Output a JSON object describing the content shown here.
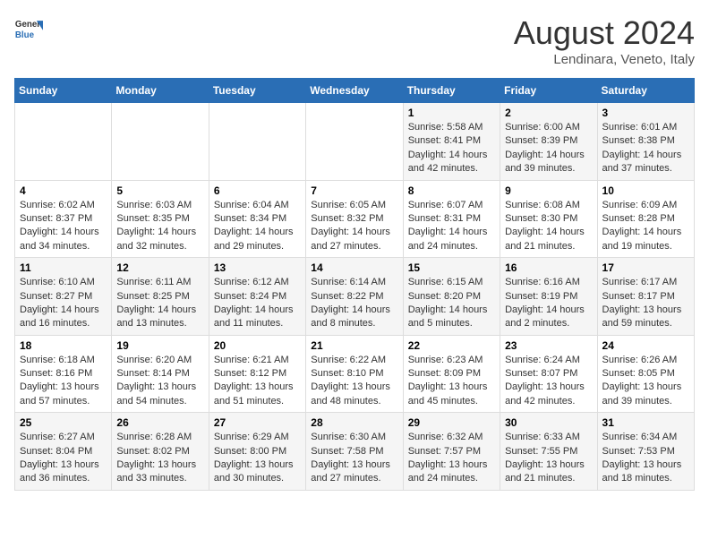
{
  "header": {
    "logo_line1": "General",
    "logo_line2": "Blue",
    "month": "August 2024",
    "location": "Lendinara, Veneto, Italy"
  },
  "days_of_week": [
    "Sunday",
    "Monday",
    "Tuesday",
    "Wednesday",
    "Thursday",
    "Friday",
    "Saturday"
  ],
  "weeks": [
    [
      {
        "day": "",
        "info": ""
      },
      {
        "day": "",
        "info": ""
      },
      {
        "day": "",
        "info": ""
      },
      {
        "day": "",
        "info": ""
      },
      {
        "day": "1",
        "info": "Sunrise: 5:58 AM\nSunset: 8:41 PM\nDaylight: 14 hours and 42 minutes."
      },
      {
        "day": "2",
        "info": "Sunrise: 6:00 AM\nSunset: 8:39 PM\nDaylight: 14 hours and 39 minutes."
      },
      {
        "day": "3",
        "info": "Sunrise: 6:01 AM\nSunset: 8:38 PM\nDaylight: 14 hours and 37 minutes."
      }
    ],
    [
      {
        "day": "4",
        "info": "Sunrise: 6:02 AM\nSunset: 8:37 PM\nDaylight: 14 hours and 34 minutes."
      },
      {
        "day": "5",
        "info": "Sunrise: 6:03 AM\nSunset: 8:35 PM\nDaylight: 14 hours and 32 minutes."
      },
      {
        "day": "6",
        "info": "Sunrise: 6:04 AM\nSunset: 8:34 PM\nDaylight: 14 hours and 29 minutes."
      },
      {
        "day": "7",
        "info": "Sunrise: 6:05 AM\nSunset: 8:32 PM\nDaylight: 14 hours and 27 minutes."
      },
      {
        "day": "8",
        "info": "Sunrise: 6:07 AM\nSunset: 8:31 PM\nDaylight: 14 hours and 24 minutes."
      },
      {
        "day": "9",
        "info": "Sunrise: 6:08 AM\nSunset: 8:30 PM\nDaylight: 14 hours and 21 minutes."
      },
      {
        "day": "10",
        "info": "Sunrise: 6:09 AM\nSunset: 8:28 PM\nDaylight: 14 hours and 19 minutes."
      }
    ],
    [
      {
        "day": "11",
        "info": "Sunrise: 6:10 AM\nSunset: 8:27 PM\nDaylight: 14 hours and 16 minutes."
      },
      {
        "day": "12",
        "info": "Sunrise: 6:11 AM\nSunset: 8:25 PM\nDaylight: 14 hours and 13 minutes."
      },
      {
        "day": "13",
        "info": "Sunrise: 6:12 AM\nSunset: 8:24 PM\nDaylight: 14 hours and 11 minutes."
      },
      {
        "day": "14",
        "info": "Sunrise: 6:14 AM\nSunset: 8:22 PM\nDaylight: 14 hours and 8 minutes."
      },
      {
        "day": "15",
        "info": "Sunrise: 6:15 AM\nSunset: 8:20 PM\nDaylight: 14 hours and 5 minutes."
      },
      {
        "day": "16",
        "info": "Sunrise: 6:16 AM\nSunset: 8:19 PM\nDaylight: 14 hours and 2 minutes."
      },
      {
        "day": "17",
        "info": "Sunrise: 6:17 AM\nSunset: 8:17 PM\nDaylight: 13 hours and 59 minutes."
      }
    ],
    [
      {
        "day": "18",
        "info": "Sunrise: 6:18 AM\nSunset: 8:16 PM\nDaylight: 13 hours and 57 minutes."
      },
      {
        "day": "19",
        "info": "Sunrise: 6:20 AM\nSunset: 8:14 PM\nDaylight: 13 hours and 54 minutes."
      },
      {
        "day": "20",
        "info": "Sunrise: 6:21 AM\nSunset: 8:12 PM\nDaylight: 13 hours and 51 minutes."
      },
      {
        "day": "21",
        "info": "Sunrise: 6:22 AM\nSunset: 8:10 PM\nDaylight: 13 hours and 48 minutes."
      },
      {
        "day": "22",
        "info": "Sunrise: 6:23 AM\nSunset: 8:09 PM\nDaylight: 13 hours and 45 minutes."
      },
      {
        "day": "23",
        "info": "Sunrise: 6:24 AM\nSunset: 8:07 PM\nDaylight: 13 hours and 42 minutes."
      },
      {
        "day": "24",
        "info": "Sunrise: 6:26 AM\nSunset: 8:05 PM\nDaylight: 13 hours and 39 minutes."
      }
    ],
    [
      {
        "day": "25",
        "info": "Sunrise: 6:27 AM\nSunset: 8:04 PM\nDaylight: 13 hours and 36 minutes."
      },
      {
        "day": "26",
        "info": "Sunrise: 6:28 AM\nSunset: 8:02 PM\nDaylight: 13 hours and 33 minutes."
      },
      {
        "day": "27",
        "info": "Sunrise: 6:29 AM\nSunset: 8:00 PM\nDaylight: 13 hours and 30 minutes."
      },
      {
        "day": "28",
        "info": "Sunrise: 6:30 AM\nSunset: 7:58 PM\nDaylight: 13 hours and 27 minutes."
      },
      {
        "day": "29",
        "info": "Sunrise: 6:32 AM\nSunset: 7:57 PM\nDaylight: 13 hours and 24 minutes."
      },
      {
        "day": "30",
        "info": "Sunrise: 6:33 AM\nSunset: 7:55 PM\nDaylight: 13 hours and 21 minutes."
      },
      {
        "day": "31",
        "info": "Sunrise: 6:34 AM\nSunset: 7:53 PM\nDaylight: 13 hours and 18 minutes."
      }
    ]
  ]
}
